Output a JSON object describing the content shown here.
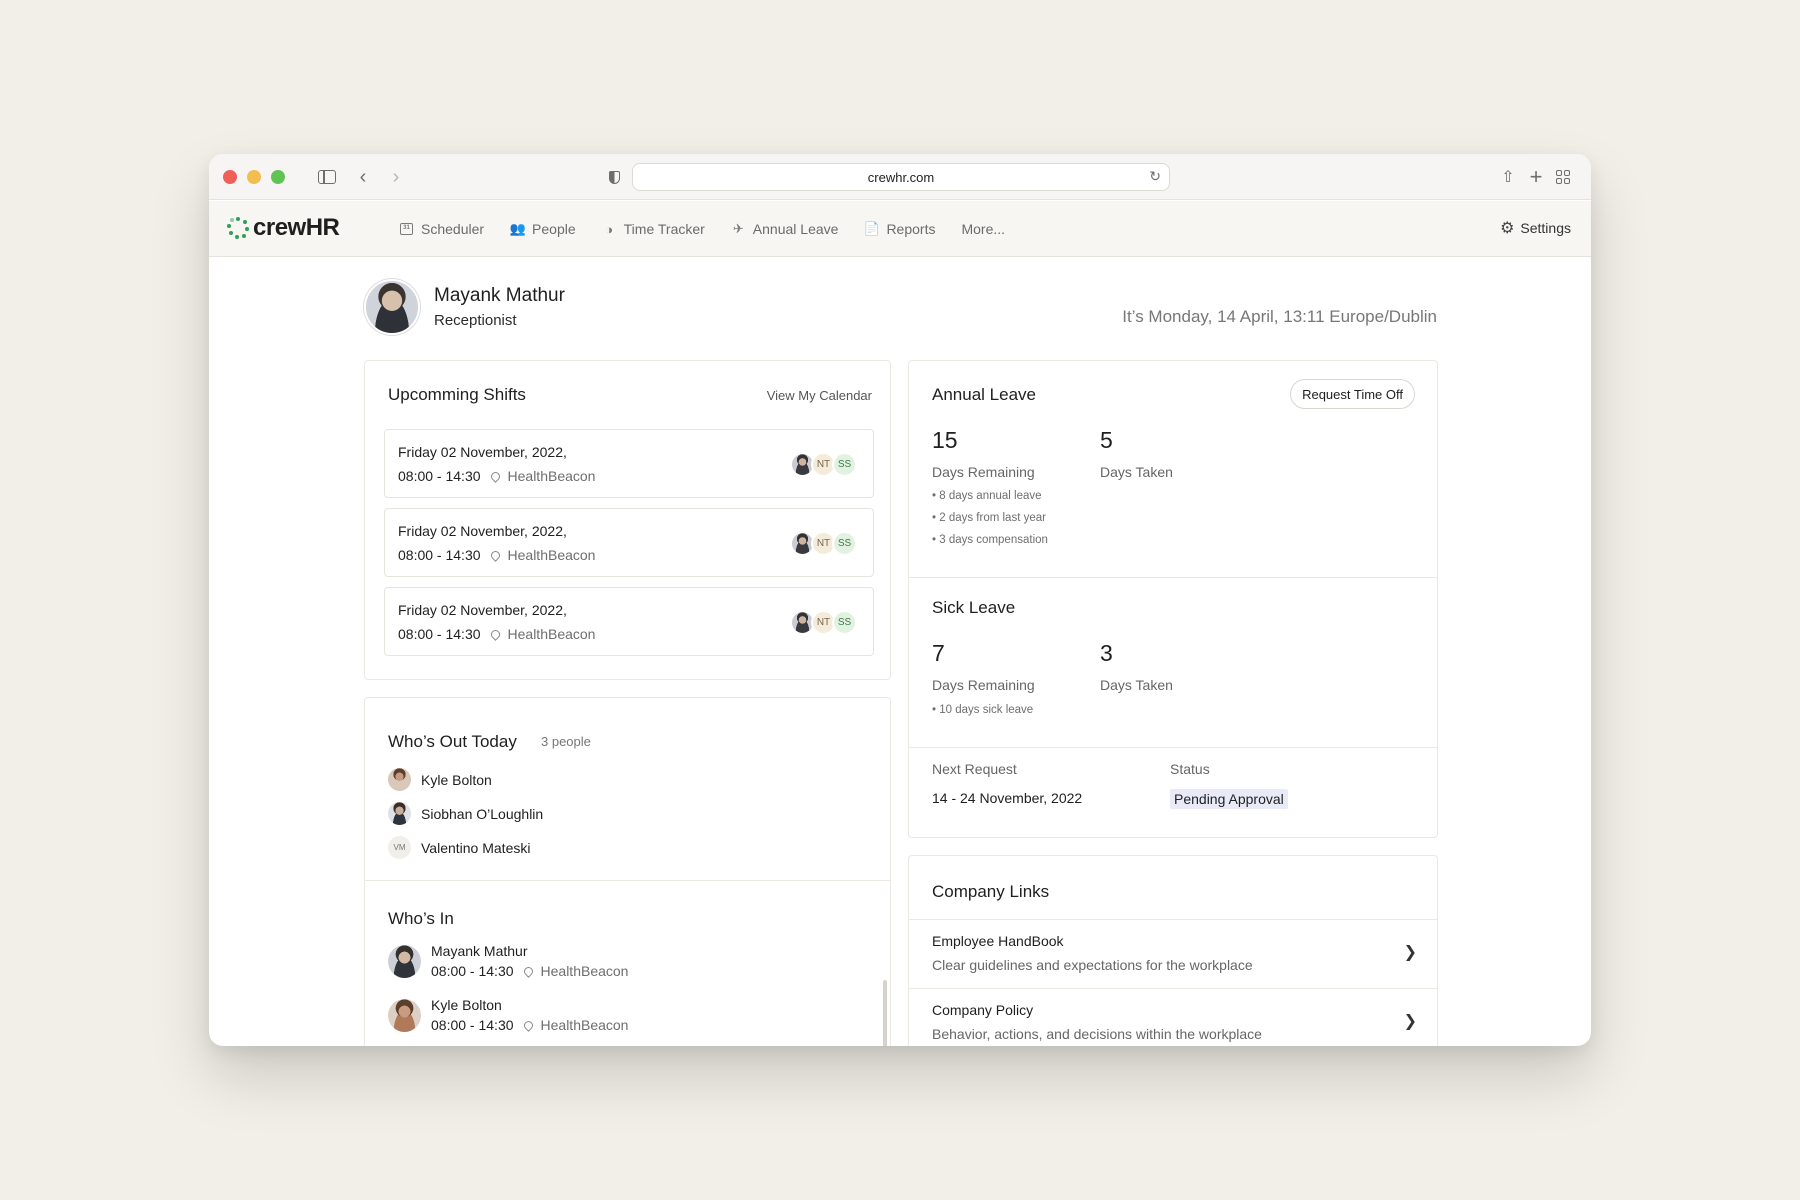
{
  "browser": {
    "url": "crewhr.com"
  },
  "brand": {
    "logo_text": "crewHR",
    "accent": "#2f9e57"
  },
  "nav": {
    "items": [
      {
        "label": "Scheduler",
        "icon": "calendar-icon"
      },
      {
        "label": "People",
        "icon": "people-icon"
      },
      {
        "label": "Time Tracker",
        "icon": "clock-icon"
      },
      {
        "label": "Annual Leave",
        "icon": "plane-icon"
      },
      {
        "label": "Reports",
        "icon": "document-icon"
      },
      {
        "label": "More...",
        "icon": ""
      }
    ],
    "settings_label": "Settings"
  },
  "profile": {
    "name": "Mayank Mathur",
    "role": "Receptionist",
    "datetime": "It’s Monday, 14 April, 13:11 Europe/Dublin"
  },
  "shifts": {
    "title": "Upcomming Shifts",
    "view_calendar": "View My Calendar",
    "items": [
      {
        "date": "Friday 02 November, 2022,",
        "time": "08:00 - 14:30",
        "location": "HealthBeacon",
        "initials": [
          "NT",
          "SS"
        ]
      },
      {
        "date": "Friday 02 November, 2022,",
        "time": "08:00 - 14:30",
        "location": "HealthBeacon",
        "initials": [
          "NT",
          "SS"
        ]
      },
      {
        "date": "Friday 02 November, 2022,",
        "time": "08:00 - 14:30",
        "location": "HealthBeacon",
        "initials": [
          "NT",
          "SS"
        ]
      }
    ]
  },
  "whos_out": {
    "title": "Who’s Out Today",
    "count": "3 people",
    "people": [
      {
        "name": "Kyle Bolton"
      },
      {
        "name": "Siobhan O’Loughlin"
      },
      {
        "name": "Valentino Mateski",
        "initials": "VM"
      }
    ]
  },
  "whos_in": {
    "title": "Who’s In",
    "people": [
      {
        "name": "Mayank Mathur",
        "time": "08:00 - 14:30",
        "location": "HealthBeacon"
      },
      {
        "name": "Kyle Bolton",
        "time": "08:00 - 14:30",
        "location": "HealthBeacon"
      }
    ]
  },
  "annual_leave": {
    "title": "Annual Leave",
    "request_button": "Request Time Off",
    "remaining": "15",
    "remaining_label": "Days Remaining",
    "taken": "5",
    "taken_label": "Days Taken",
    "breakdown": [
      "8 days annual leave",
      "2 days from last year",
      "3 days compensation"
    ]
  },
  "sick_leave": {
    "title": "Sick Leave",
    "remaining": "7",
    "remaining_label": "Days Remaining",
    "taken": "3",
    "taken_label": "Days Taken",
    "breakdown": [
      "10 days sick leave"
    ]
  },
  "next_request": {
    "label": "Next Request",
    "value": "14 - 24 November, 2022",
    "status_label": "Status",
    "status": "Pending Approval"
  },
  "company_links": {
    "title": "Company Links",
    "items": [
      {
        "title": "Employee HandBook",
        "description": "Clear guidelines and expectations for the workplace"
      },
      {
        "title": "Company Policy",
        "description": "Behavior, actions, and decisions within the workplace"
      }
    ]
  }
}
